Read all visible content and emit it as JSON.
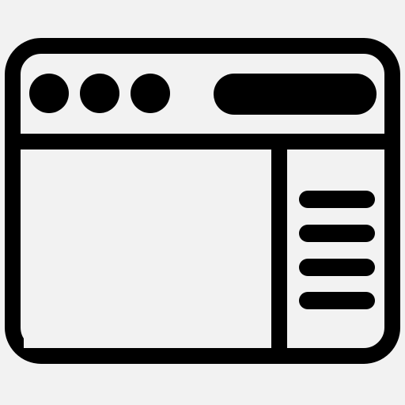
{
  "icon": {
    "name": "browser-window-layout-icon",
    "stroke_color": "#000000",
    "fill_color": "#000000",
    "background_color": "#f2f2f2",
    "panel_color": "#f2f2f2",
    "window_controls": [
      "control-dot",
      "control-dot",
      "control-dot"
    ],
    "sidebar_lines": 4
  }
}
